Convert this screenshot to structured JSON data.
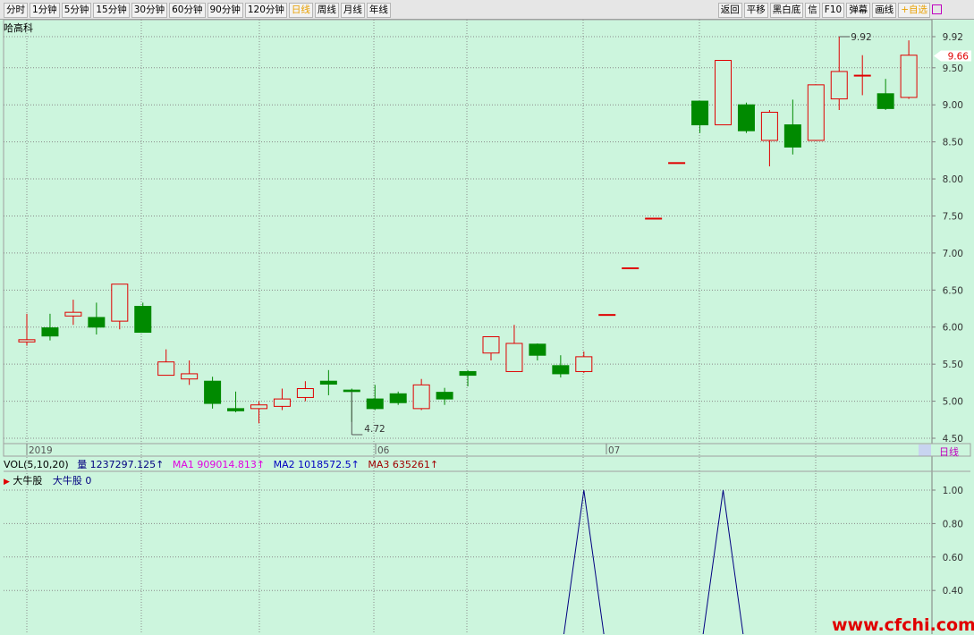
{
  "toolbar": {
    "left": [
      "分时",
      "1分钟",
      "5分钟",
      "15分钟",
      "30分钟",
      "60分钟",
      "90分钟",
      "120分钟",
      "日线",
      "周线",
      "月线",
      "年线"
    ],
    "active_index": 8,
    "right": [
      "返回",
      "平移",
      "黑白底",
      "信",
      "F10",
      "弹幕",
      "画线",
      "+自选"
    ]
  },
  "symbol": "哈高科",
  "period_label": "日线",
  "price_axis": [
    "9.92",
    "9.50",
    "9.00",
    "8.50",
    "8.00",
    "7.50",
    "7.00",
    "6.50",
    "6.00",
    "5.50",
    "5.00",
    "4.50"
  ],
  "current_price": "9.66",
  "annotations": {
    "high": "9.92",
    "low": "4.72"
  },
  "time_axis": [
    "2019",
    "06",
    "07"
  ],
  "volume_bar": {
    "title": "VOL(5,10,20)",
    "vol": "量 1237297.125↑",
    "ma1": "MA1 909014.813↑",
    "ma2": "MA2 1018572.5↑",
    "ma3": "MA3 635261↑"
  },
  "indicator": {
    "name": "大牛股",
    "label": "大牛股",
    "value": "0"
  },
  "indicator_axis": [
    "1.00",
    "0.80",
    "0.60",
    "0.40"
  ],
  "watermark": "www.cfchi.com",
  "colors": {
    "up": "#e00000",
    "down": "#008a00",
    "background": "#ccf5dd",
    "indicator_line": "#000080"
  },
  "chart_data": {
    "type": "candlestick",
    "ylim": [
      4.5,
      9.92
    ],
    "candles": [
      {
        "o": 5.8,
        "c": 5.83,
        "h": 6.18,
        "l": 5.75
      },
      {
        "o": 5.99,
        "c": 5.88,
        "h": 6.18,
        "l": 5.82
      },
      {
        "o": 6.15,
        "c": 6.2,
        "h": 6.37,
        "l": 6.03
      },
      {
        "o": 6.13,
        "c": 6.0,
        "h": 6.33,
        "l": 5.9
      },
      {
        "o": 6.08,
        "c": 6.58,
        "h": 6.58,
        "l": 5.97
      },
      {
        "o": 6.28,
        "c": 5.93,
        "h": 6.33,
        "l": 5.93
      },
      {
        "o": 5.35,
        "c": 5.53,
        "h": 5.7,
        "l": 5.35
      },
      {
        "o": 5.3,
        "c": 5.37,
        "h": 5.55,
        "l": 5.22
      },
      {
        "o": 5.27,
        "c": 4.97,
        "h": 5.33,
        "l": 4.9
      },
      {
        "o": 4.9,
        "c": 4.87,
        "h": 5.13,
        "l": 4.85
      },
      {
        "o": 4.9,
        "c": 4.95,
        "h": 5.0,
        "l": 4.7
      },
      {
        "o": 4.93,
        "c": 5.03,
        "h": 5.17,
        "l": 4.88
      },
      {
        "o": 5.05,
        "c": 5.17,
        "h": 5.27,
        "l": 5.0
      },
      {
        "o": 5.27,
        "c": 5.23,
        "h": 5.42,
        "l": 5.08
      },
      {
        "o": 5.15,
        "c": 5.13,
        "h": 5.17,
        "l": 4.72
      },
      {
        "o": 5.03,
        "c": 4.9,
        "h": 5.22,
        "l": 4.88
      },
      {
        "o": 5.1,
        "c": 4.98,
        "h": 5.13,
        "l": 4.95
      },
      {
        "o": 4.9,
        "c": 5.22,
        "h": 5.3,
        "l": 4.88
      },
      {
        "o": 5.12,
        "c": 5.03,
        "h": 5.18,
        "l": 4.95
      },
      {
        "o": 5.4,
        "c": 5.35,
        "h": 5.42,
        "l": 5.2
      },
      {
        "o": 5.65,
        "c": 5.87,
        "h": 5.87,
        "l": 5.55
      },
      {
        "o": 5.4,
        "c": 5.78,
        "h": 6.03,
        "l": 5.4
      },
      {
        "o": 5.77,
        "c": 5.62,
        "h": 5.78,
        "l": 5.55
      },
      {
        "o": 5.48,
        "c": 5.37,
        "h": 5.62,
        "l": 5.32
      },
      {
        "o": 5.4,
        "c": 5.6,
        "h": 5.67,
        "l": 5.38
      },
      {
        "o": 6.17,
        "c": 6.17,
        "h": 6.17,
        "l": 6.17
      },
      {
        "o": 6.8,
        "c": 6.8,
        "h": 6.8,
        "l": 6.8
      },
      {
        "o": 7.47,
        "c": 7.47,
        "h": 7.47,
        "l": 7.47
      },
      {
        "o": 8.22,
        "c": 8.22,
        "h": 8.22,
        "l": 8.22
      },
      {
        "o": 9.05,
        "c": 8.73,
        "h": 9.05,
        "l": 8.62
      },
      {
        "o": 8.73,
        "c": 9.6,
        "h": 9.6,
        "l": 8.73
      },
      {
        "o": 9.0,
        "c": 8.65,
        "h": 9.03,
        "l": 8.62
      },
      {
        "o": 8.52,
        "c": 8.9,
        "h": 8.93,
        "l": 8.17
      },
      {
        "o": 8.73,
        "c": 8.43,
        "h": 9.07,
        "l": 8.33
      },
      {
        "o": 8.52,
        "c": 9.27,
        "h": 9.27,
        "l": 8.52
      },
      {
        "o": 9.08,
        "c": 9.45,
        "h": 9.92,
        "l": 8.93
      },
      {
        "o": 9.4,
        "c": 9.4,
        "h": 9.67,
        "l": 9.13
      },
      {
        "o": 9.15,
        "c": 8.95,
        "h": 9.35,
        "l": 8.93
      },
      {
        "o": 9.1,
        "c": 9.67,
        "h": 9.87,
        "l": 9.08
      }
    ],
    "indicator": {
      "name": "大牛股",
      "ylim": [
        0,
        1
      ],
      "peaks_at_candle_index": [
        24,
        30
      ]
    }
  }
}
